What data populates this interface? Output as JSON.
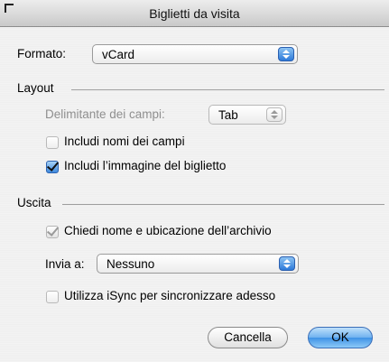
{
  "window": {
    "title": "Biglietti da visita"
  },
  "format": {
    "label": "Formato:",
    "value": "vCard"
  },
  "layout": {
    "section_title": "Layout",
    "delimiter_label": "Delimitante dei campi:",
    "delimiter_value": "Tab",
    "include_field_names": {
      "label": "Includi nomi dei campi",
      "checked": false
    },
    "include_card_image": {
      "label": "Includi l’immagine del biglietto",
      "checked": true
    }
  },
  "output": {
    "section_title": "Uscita",
    "ask_name_location": {
      "label": "Chiedi nome e ubicazione dell’archivio",
      "checked": true
    },
    "send_to_label": "Invia a:",
    "send_to_value": "Nessuno",
    "use_isync": {
      "label": "Utilizza iSync per sincronizzare adesso",
      "checked": false
    }
  },
  "buttons": {
    "cancel": "Cancella",
    "ok": "OK"
  },
  "colors": {
    "accent": "#3f92e6",
    "window_bg": "#ececec"
  }
}
